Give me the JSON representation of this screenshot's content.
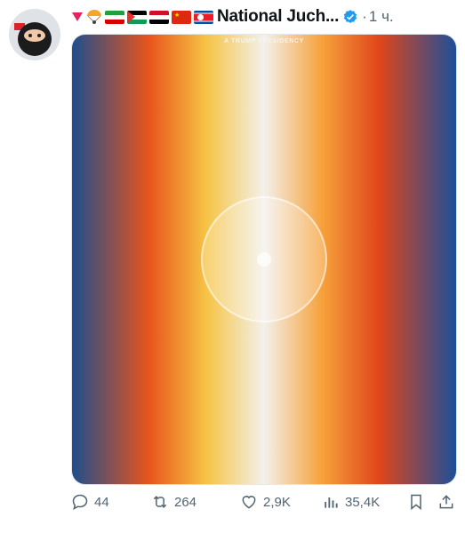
{
  "author": {
    "display_name": "National Juch...",
    "verified": true,
    "separator": "·",
    "time": "1 ч.",
    "name_prefix_icons": [
      "triangle-down-icon",
      "parachute-icon",
      "flag-iran-icon",
      "flag-palestine-icon",
      "flag-yemen-icon",
      "flag-china-icon",
      "flag-north-korea-icon"
    ]
  },
  "media": {
    "tagline": "A TRUMP PRESIDENCY"
  },
  "actions": {
    "replies": "44",
    "reposts": "264",
    "likes": "2,9K",
    "views": "35,4K"
  },
  "colors": {
    "text": "#0f1419",
    "muted": "#536471",
    "verified": "#1d9bf0"
  }
}
